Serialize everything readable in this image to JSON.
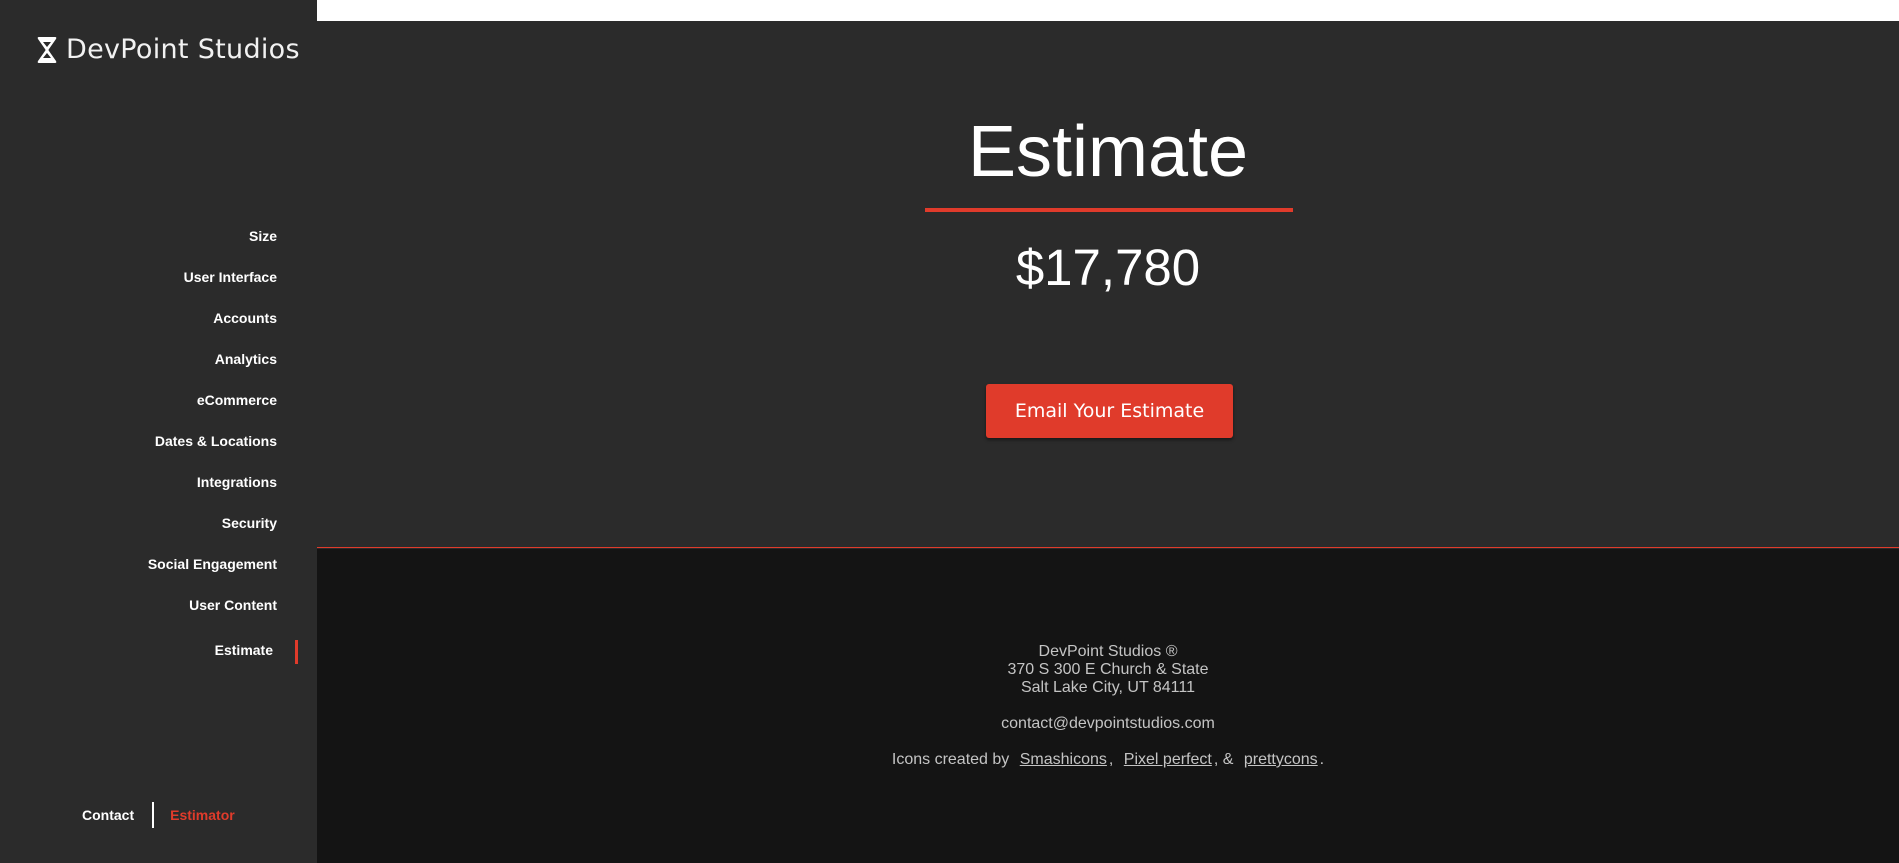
{
  "brand": {
    "name": "DevPoint Studios"
  },
  "sidebar": {
    "items": [
      {
        "label": "Size"
      },
      {
        "label": "User Interface"
      },
      {
        "label": "Accounts"
      },
      {
        "label": "Analytics"
      },
      {
        "label": "eCommerce"
      },
      {
        "label": "Dates & Locations"
      },
      {
        "label": "Integrations"
      },
      {
        "label": "Security"
      },
      {
        "label": "Social Engagement"
      },
      {
        "label": "User Content"
      },
      {
        "label": "Estimate"
      }
    ],
    "active_index": 10,
    "footer": {
      "contact_label": "Contact",
      "estimator_label": "Estimator"
    }
  },
  "main": {
    "title": "Estimate",
    "price": "$17,780",
    "email_button_label": "Email Your Estimate"
  },
  "footer": {
    "company": "DevPoint Studios ®",
    "address_line1": "370 S 300 E Church & State",
    "address_line2": "Salt Lake City, UT 84111",
    "email": "contact@devpointstudios.com",
    "credits_prefix": "Icons created by",
    "credit_1": "Smashicons",
    "credit_sep_1": ",",
    "credit_2": "Pixel perfect",
    "credit_sep_2": ", &",
    "credit_3": "prettycons",
    "credits_suffix": "."
  },
  "colors": {
    "accent": "#e03b2b",
    "sidebar_bg": "#2b2b2b",
    "footer_bg": "#141414"
  }
}
